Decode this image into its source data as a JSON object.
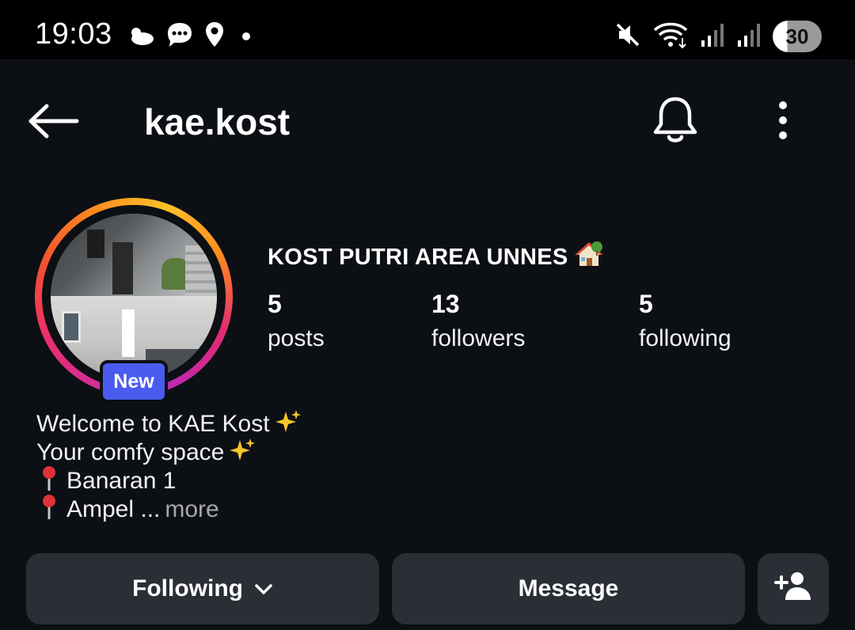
{
  "status_bar": {
    "time": "19:03",
    "left_icons": [
      "cloud-icon",
      "chat-bubble-icon",
      "location-pin-icon",
      "dot-icon"
    ],
    "right_icons": [
      "mute-icon",
      "wifi-icon",
      "signal-icon",
      "signal-icon"
    ],
    "battery": "30"
  },
  "header": {
    "username": "kae.kost",
    "icons": [
      "back-arrow-icon",
      "bell-icon",
      "more-vertical-icon"
    ]
  },
  "profile": {
    "display_name": "KOST PUTRI AREA UNNES",
    "new_badge": "New",
    "stats": [
      {
        "value": "5",
        "label": "posts"
      },
      {
        "value": "13",
        "label": "followers"
      },
      {
        "value": "5",
        "label": "following"
      }
    ],
    "bio": {
      "line1": "Welcome to KAE Kost",
      "line2": "Your comfy space",
      "line3": "Banaran 1",
      "line4": "Ampel ...",
      "more": "more"
    }
  },
  "actions": {
    "following_label": "Following",
    "message_label": "Message"
  },
  "colors": {
    "background": "#0c0f14",
    "button_bg": "#2a2e35",
    "badge": "#4a5cf0",
    "muted_text": "#a8a8a8"
  }
}
